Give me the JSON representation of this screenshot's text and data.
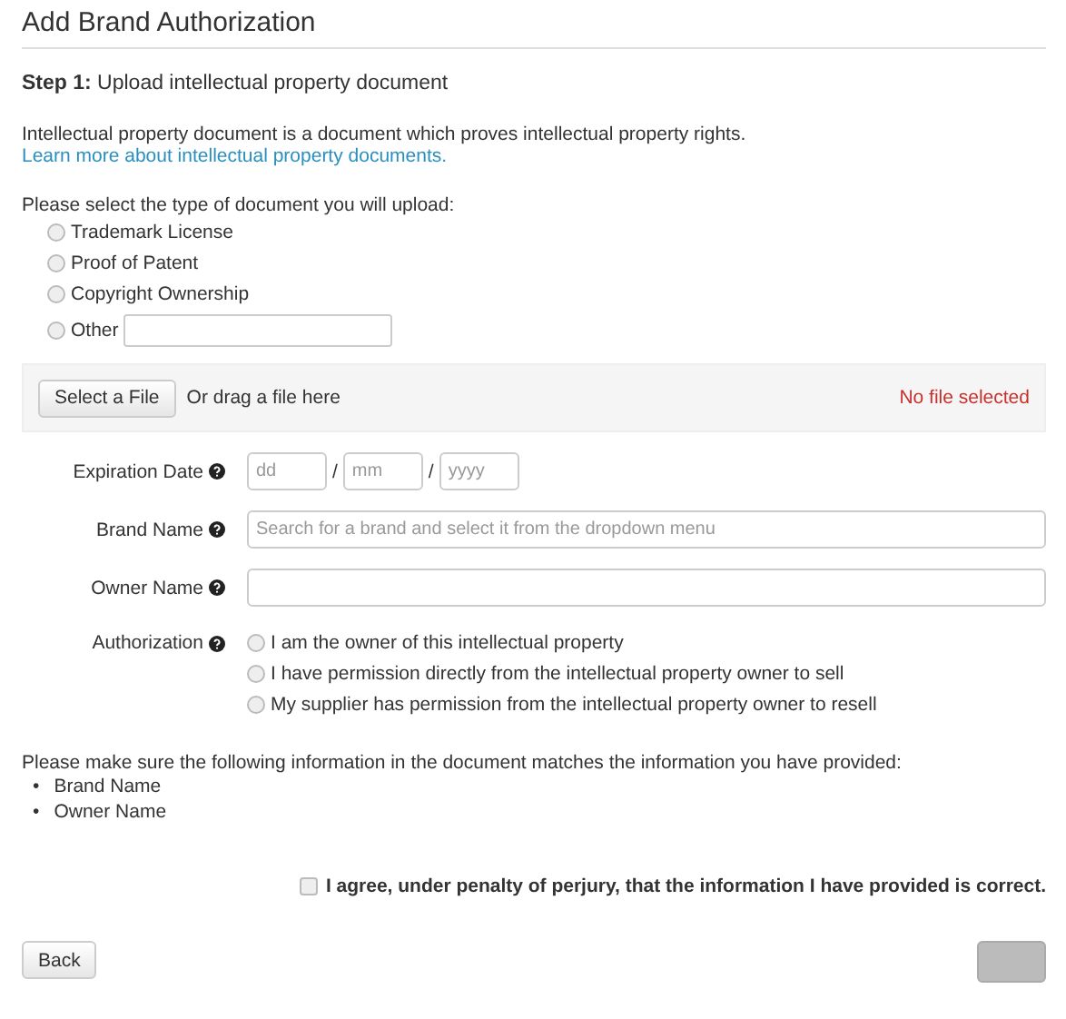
{
  "title": "Add Brand Authorization",
  "step": {
    "label": "Step 1:",
    "text": "Upload intellectual property document"
  },
  "intro": "Intellectual property document is a document which proves intellectual property rights.",
  "learn_more_link": "Learn more about intellectual property documents.",
  "document_type": {
    "prompt": "Please select the type of document you will upload:",
    "options": [
      {
        "label": "Trademark License",
        "selected": false,
        "kind": "plain"
      },
      {
        "label": "Proof of Patent",
        "selected": false,
        "kind": "plain"
      },
      {
        "label": "Copyright Ownership",
        "selected": false,
        "kind": "plain"
      },
      {
        "label": "Other",
        "selected": false,
        "kind": "text"
      }
    ]
  },
  "upload": {
    "button": "Select a File",
    "hint": "Or drag a file here",
    "status": "No file selected"
  },
  "expiration_date": {
    "label": "Expiration Date",
    "fields": [
      {
        "placeholder": "dd"
      },
      {
        "placeholder": "mm"
      },
      {
        "placeholder": "yyyy"
      }
    ],
    "separators": [
      "/",
      "/"
    ]
  },
  "brand_name": {
    "label": "Brand Name",
    "placeholder": "Search for a brand and select it from the dropdown menu"
  },
  "owner_name": {
    "label": "Owner Name"
  },
  "authorization": {
    "label": "Authorization",
    "options": [
      {
        "label": "I am the owner of this intellectual property",
        "selected": false
      },
      {
        "label": "I have permission directly from the intellectual property owner to sell",
        "selected": false
      },
      {
        "label": "My supplier has permission from the intellectual property owner to resell",
        "selected": false
      }
    ]
  },
  "match_note": "Please make sure the following information in the document matches the information you have provided:",
  "match_items": [
    {
      "bullet": "•",
      "text": "Brand Name"
    },
    {
      "bullet": "•",
      "text": "Owner Name"
    }
  ],
  "agreement": {
    "label": "I agree, under penalty of perjury, that the information I have provided is correct.",
    "checked": false
  },
  "back_button": "Back",
  "submit_button": {
    "disabled": true
  }
}
